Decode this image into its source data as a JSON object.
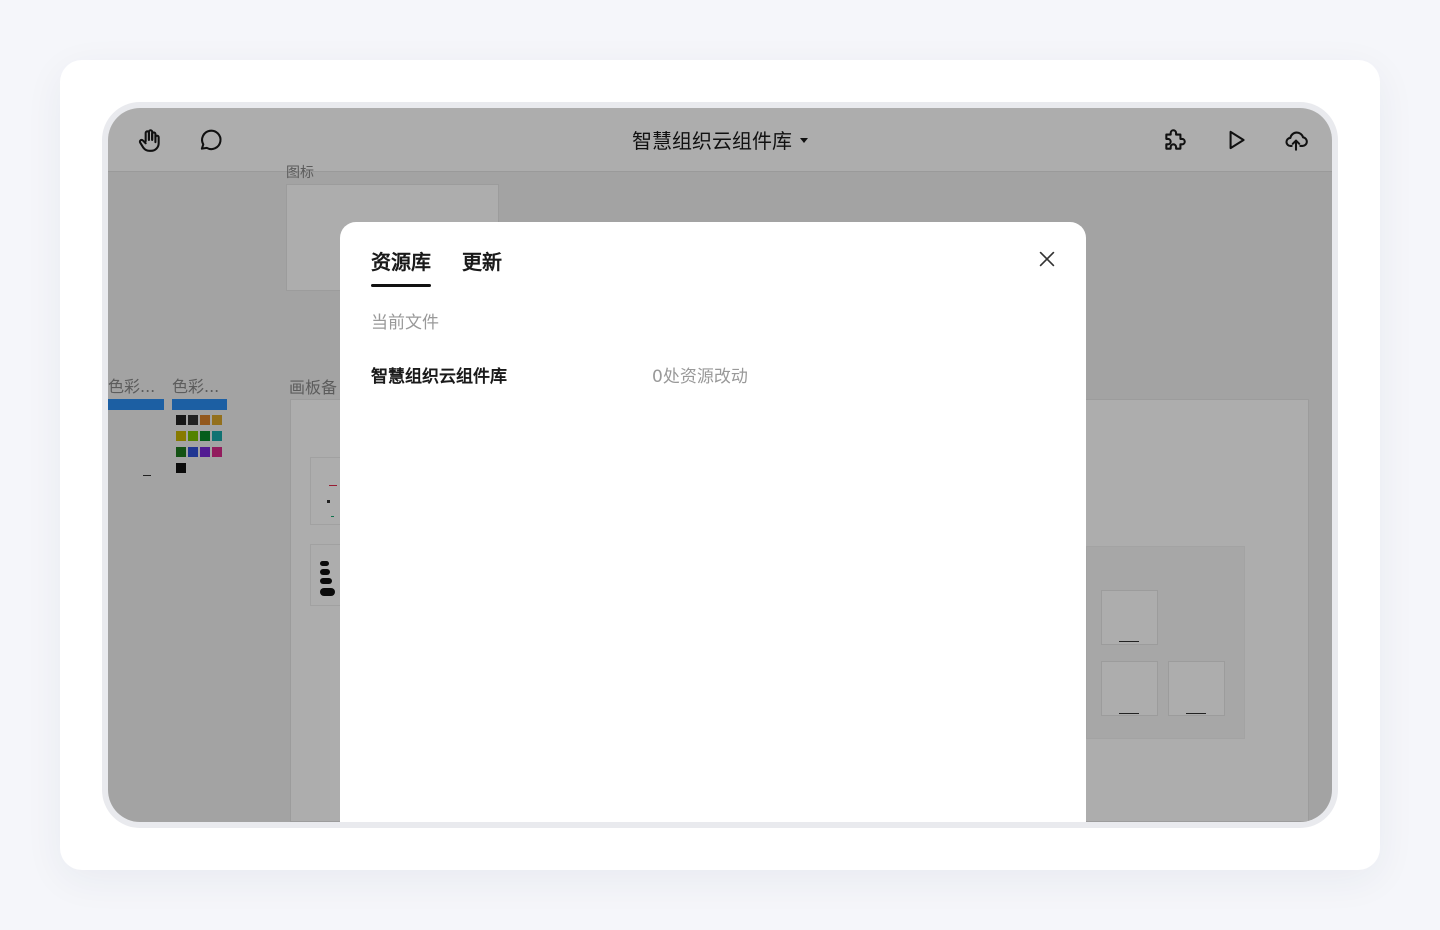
{
  "toolbar": {
    "title": "智慧组织云组件库",
    "icons": [
      "hand-icon",
      "comment-icon",
      "plugin-icon",
      "play-icon",
      "cloud-upload-icon"
    ]
  },
  "canvas": {
    "icon_frame_label": "图标",
    "color_labels": [
      "色彩...",
      "色彩..."
    ],
    "artboard_label": "画板备",
    "swatches": [
      "#222222",
      "#333333",
      "#d9822b",
      "#d9a52b",
      "#c8b400",
      "#7ac000",
      "#0a8a2a",
      "#18a8a8",
      "#1e7a1e",
      "#3050d8",
      "#7a2ad8",
      "#d82a8a",
      "#111111"
    ]
  },
  "modal": {
    "tabs": [
      {
        "label": "资源库",
        "active": true
      },
      {
        "label": "更新",
        "active": false
      }
    ],
    "section_title": "当前文件",
    "library": {
      "name": "智慧组织云组件库",
      "changes": "0处资源改动"
    }
  },
  "colors": {
    "page_bg": "#f5f6fa",
    "overlay": "rgba(0,0,0,0.32)",
    "accent_bar": "#2a8cf0",
    "text_primary": "#1a1a1a",
    "text_secondary": "#999999"
  }
}
